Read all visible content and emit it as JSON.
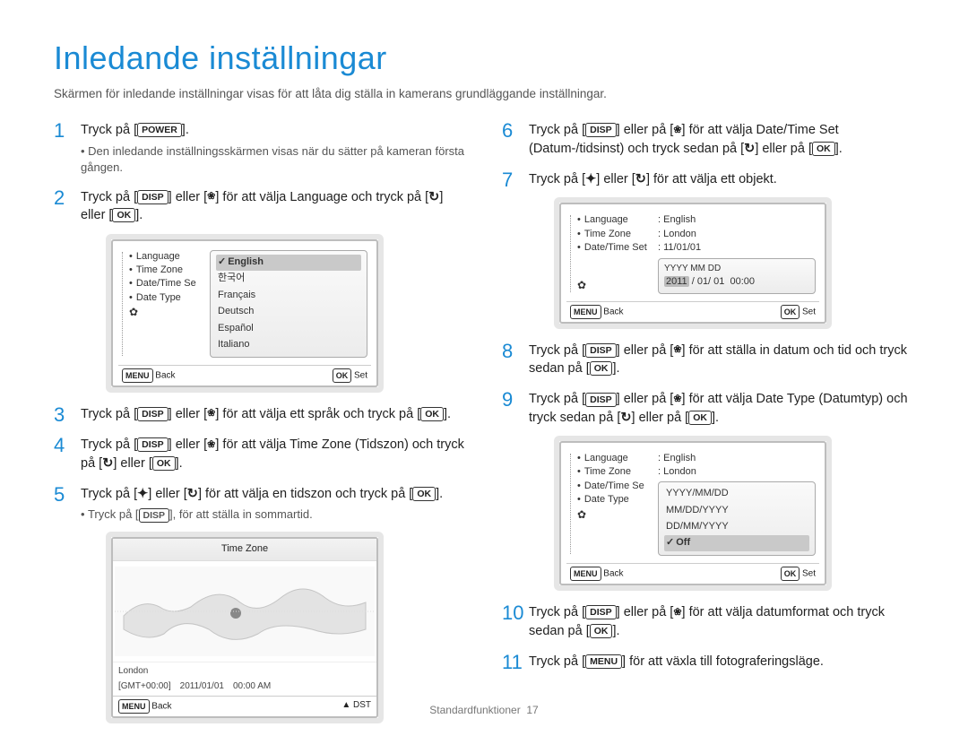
{
  "title": "Inledande inställningar",
  "intro": "Skärmen för inledande inställningar visas för att låta dig ställa in kamerans grundläggande inställningar.",
  "buttons": {
    "power": "POWER",
    "disp": "DISP",
    "ok": "OK",
    "menu": "MENU"
  },
  "icons": {
    "flower": "❀",
    "timer_right": "↻",
    "flash": "✦",
    "up": "▲"
  },
  "left_steps": {
    "s1": {
      "num": "1",
      "text_a": "Tryck på [",
      "text_b": "]."
    },
    "s1_sub": "Den inledande inställningsskärmen visas när du sätter på kameran första gången.",
    "s2": {
      "num": "2",
      "text_a": "Tryck på [",
      "text_b": "] eller [",
      "text_c": "] för att välja Language och tryck på [",
      "text_d": "] eller [",
      "text_e": "]."
    },
    "s3": {
      "num": "3",
      "text_a": "Tryck på [",
      "text_b": "] eller [",
      "text_c": "] för att välja ett språk och tryck på [",
      "text_d": "]."
    },
    "s4": {
      "num": "4",
      "text_a": "Tryck på [",
      "text_b": "] eller [",
      "text_c": "] för att välja Time Zone (Tidszon) och tryck på [",
      "text_d": "] eller [",
      "text_e": "]."
    },
    "s5": {
      "num": "5",
      "text_a": "Tryck på [",
      "text_b": "] eller [",
      "text_c": "] för att välja en tidszon och tryck på [",
      "text_d": "]."
    },
    "s5_sub": {
      "a": "Tryck på [",
      "b": "], för att ställa in sommartid."
    }
  },
  "right_steps": {
    "s6": {
      "num": "6",
      "text_a": "Tryck på [",
      "text_b": "] eller på [",
      "text_c": "] för att välja Date/Time Set (Datum-/tidsinst) och tryck sedan på [",
      "text_d": "] eller på [",
      "text_e": "]."
    },
    "s7": {
      "num": "7",
      "text_a": "Tryck på [",
      "text_b": "] eller [",
      "text_c": "] för att välja ett objekt."
    },
    "s8": {
      "num": "8",
      "text_a": "Tryck på [",
      "text_b": "] eller på [",
      "text_c": "] för att ställa in datum och tid och tryck sedan på [",
      "text_d": "]."
    },
    "s9": {
      "num": "9",
      "text_a": "Tryck på [",
      "text_b": "] eller på [",
      "text_c": "] för att välja Date Type (Datumtyp) och tryck sedan på [",
      "text_d": "] eller på [",
      "text_e": "]."
    },
    "s10": {
      "num": "10",
      "text_a": "Tryck på [",
      "text_b": "] eller på [",
      "text_c": "] för att välja datumformat och tryck sedan på [",
      "text_d": "]."
    },
    "s11": {
      "num": "11",
      "text_a": "Tryck på [",
      "text_b": "] för att växla till fotograferingsläge."
    }
  },
  "lcd1": {
    "menu": [
      "Language",
      "Time Zone",
      "Date/Time Se",
      "Date Type"
    ],
    "options": [
      "English",
      "한국어",
      "Français",
      "Deutsch",
      "Español",
      "Italiano"
    ],
    "selected": "English",
    "footer_back": "Back",
    "footer_set": "Set"
  },
  "timezone": {
    "title": "Time Zone",
    "city": "London",
    "gmt": "[GMT+00:00]",
    "date": "2011/01/01",
    "time": "00:00 AM",
    "footer_back": "Back",
    "footer_dst": "DST"
  },
  "lcd2": {
    "rows": {
      "Language": "English",
      "Time Zone": "London",
      "Date/Time Set": "11/01/01"
    },
    "popup_label": "YYYY MM DD",
    "popup_value": "2011 / 01/ 01  00:00",
    "popup_highlight": "2011",
    "footer_back": "Back",
    "footer_set": "Set"
  },
  "lcd3": {
    "rows": {
      "Language": "English",
      "Time Zone": "London",
      "Date/Time Se": "",
      "Date Type": ""
    },
    "options": [
      "YYYY/MM/DD",
      "MM/DD/YYYY",
      "DD/MM/YYYY",
      "Off"
    ],
    "selected": "Off",
    "footer_back": "Back",
    "footer_set": "Set"
  },
  "footer": {
    "section": "Standardfunktioner",
    "page": "17"
  }
}
